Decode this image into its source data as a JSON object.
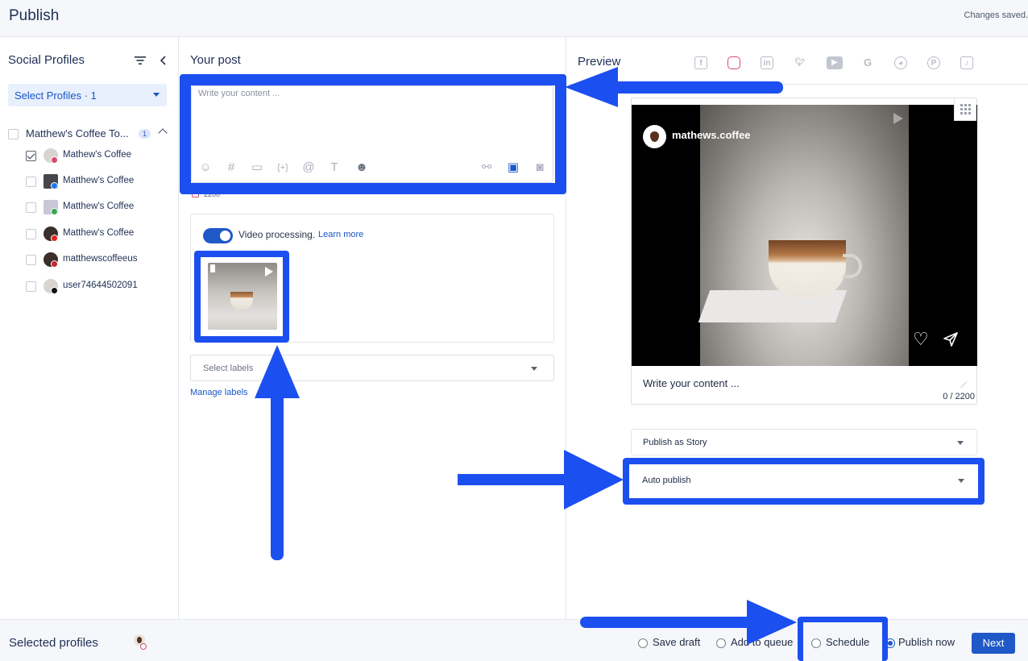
{
  "header": {
    "title": "Publish",
    "status": "Changes saved."
  },
  "sidebar": {
    "title": "Social Profiles",
    "select_label": "Select Profiles · 1",
    "group": {
      "name": "Matthew's Coffee To...",
      "badge": "1"
    },
    "profiles": [
      {
        "name": "Mathew's Coffee",
        "checked": true,
        "network": "instagram"
      },
      {
        "name": "Matthew's Coffee",
        "checked": false,
        "network": "facebook"
      },
      {
        "name": "Matthew's Coffee",
        "checked": false,
        "network": "google"
      },
      {
        "name": "Matthew's Coffee",
        "checked": false,
        "network": "youtube"
      },
      {
        "name": "matthewscoffeeus",
        "checked": false,
        "network": "pinterest"
      },
      {
        "name": "user74644502091",
        "checked": false,
        "network": "tiktok"
      }
    ]
  },
  "composer": {
    "title": "Your post",
    "placeholder": "Write your content ...",
    "char_limit": "2200",
    "video_processing": "Video processing.",
    "learn_more": "Learn more",
    "labels_placeholder": "Select labels",
    "manage_labels": "Manage labels",
    "toolbar_icons": [
      "emoji-icon",
      "hashtag-icon",
      "snippet-icon",
      "variable-icon",
      "mention-icon",
      "text-format-icon",
      "ai-assistant-icon",
      "link-icon",
      "video-icon",
      "camera-icon"
    ]
  },
  "preview": {
    "title": "Preview",
    "networks": [
      "facebook",
      "instagram",
      "linkedin",
      "twitter",
      "youtube",
      "google",
      "reddit",
      "pinterest",
      "tiktok"
    ],
    "active_network": "instagram",
    "username": "mathews.coffee",
    "caption": "Write your content ...",
    "count": "0 / 2200",
    "post_type": "Publish as Story",
    "publish_mode": "Auto publish"
  },
  "footer": {
    "selected_profiles": "Selected profiles",
    "options": [
      "Save draft",
      "Add to queue",
      "Schedule",
      "Publish now"
    ],
    "selected_option": "Publish now",
    "next": "Next"
  },
  "colors": {
    "accent": "#1f58c7",
    "annotation": "#1c4ff0",
    "instagram": "#d94a6a"
  }
}
